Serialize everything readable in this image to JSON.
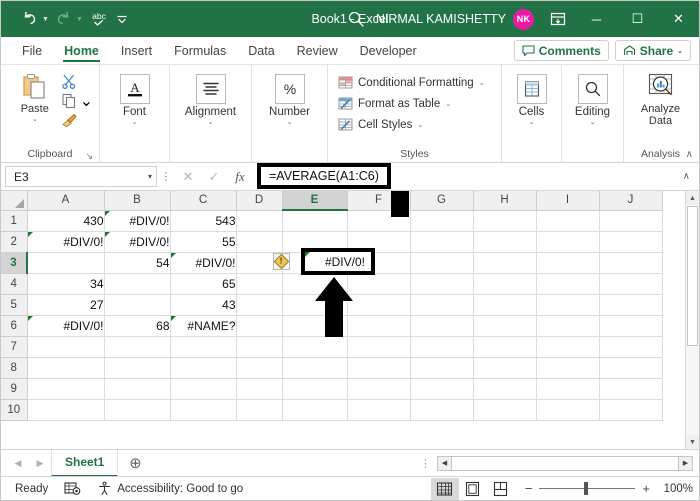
{
  "titlebar": {
    "document_title": "Book1 - Excel",
    "user_name": "NIRMAL KAMISHETTY",
    "avatar_initials": "NK",
    "qat": [
      {
        "name": "undo",
        "label": "↶"
      },
      {
        "name": "redo",
        "label": "↷"
      },
      {
        "name": "spelling",
        "label": "abc"
      },
      {
        "name": "customize-qat",
        "label": "⌄"
      }
    ],
    "window_buttons": {
      "minimize": "─",
      "maximize": "☐",
      "close": "✕"
    },
    "brand_color": "#217346",
    "avatar_color": "#e81aa4"
  },
  "tabs": [
    {
      "label": "File",
      "active": false
    },
    {
      "label": "Home",
      "active": true
    },
    {
      "label": "Insert",
      "active": false
    },
    {
      "label": "Formulas",
      "active": false
    },
    {
      "label": "Data",
      "active": false
    },
    {
      "label": "Review",
      "active": false
    },
    {
      "label": "Developer",
      "active": false
    }
  ],
  "tabstrip_right": {
    "comments_label": "Comments",
    "share_label": "Share",
    "share_caret": "⌄"
  },
  "ribbon": {
    "groups": [
      {
        "name": "clipboard",
        "label": "Clipboard",
        "dialog_launcher": "↘",
        "buttons": [
          {
            "name": "paste",
            "label": "Paste",
            "caret": "⌄"
          },
          {
            "name": "cut",
            "label": ""
          },
          {
            "name": "copy",
            "label": "",
            "caret": "⌄"
          },
          {
            "name": "format-painter",
            "label": ""
          }
        ]
      },
      {
        "name": "font",
        "label": "",
        "button": {
          "name": "font",
          "label": "Font",
          "caret": "⌄"
        }
      },
      {
        "name": "alignment",
        "label": "",
        "button": {
          "name": "alignment",
          "label": "Alignment",
          "caret": "⌄"
        }
      },
      {
        "name": "number",
        "label": "",
        "button": {
          "name": "number",
          "label": "Number",
          "caret": "⌄"
        }
      },
      {
        "name": "styles",
        "label": "Styles",
        "items": [
          {
            "name": "conditional-formatting",
            "label": "Conditional Formatting",
            "caret": "⌄"
          },
          {
            "name": "format-as-table",
            "label": "Format as Table",
            "caret": "⌄"
          },
          {
            "name": "cell-styles",
            "label": "Cell Styles",
            "caret": "⌄"
          }
        ]
      },
      {
        "name": "cells",
        "label": "",
        "button": {
          "name": "cells",
          "label": "Cells",
          "caret": "⌄"
        }
      },
      {
        "name": "editing",
        "label": "",
        "button": {
          "name": "editing",
          "label": "Editing",
          "caret": "⌄"
        }
      },
      {
        "name": "analysis",
        "label": "Analysis",
        "button": {
          "name": "analyze-data",
          "label_line1": "Analyze",
          "label_line2": "Data"
        }
      }
    ],
    "collapse_caret": "∧"
  },
  "formula_bar": {
    "name_box_value": "E3",
    "name_box_caret": "▾",
    "cancel_icon": "✕",
    "enter_icon": "✓",
    "fx_label": "fx",
    "formula_value": "=AVERAGE(A1:C6)",
    "expand_caret": "∧"
  },
  "grid": {
    "columns": [
      "A",
      "B",
      "C",
      "D",
      "E",
      "F",
      "G",
      "H",
      "I",
      "J"
    ],
    "selected_column": "E",
    "rows": [
      "1",
      "2",
      "3",
      "4",
      "5",
      "6",
      "7",
      "8",
      "9",
      "10"
    ],
    "selected_row": "3",
    "active_cell": "E3",
    "active_cell_value": "#DIV/0!",
    "error_indicator_tooltip": "!",
    "cells": [
      {
        "ref": "A1",
        "value": "430",
        "type": "num",
        "flag": false
      },
      {
        "ref": "B1",
        "value": "#DIV/0!",
        "type": "err",
        "flag": true
      },
      {
        "ref": "C1",
        "value": "543",
        "type": "num",
        "flag": false
      },
      {
        "ref": "A2",
        "value": "#DIV/0!",
        "type": "err",
        "flag": true
      },
      {
        "ref": "B2",
        "value": "#DIV/0!",
        "type": "err",
        "flag": true
      },
      {
        "ref": "C2",
        "value": "55",
        "type": "num",
        "flag": false
      },
      {
        "ref": "B3",
        "value": "54",
        "type": "num",
        "flag": false
      },
      {
        "ref": "C3",
        "value": "#DIV/0!",
        "type": "err",
        "flag": true
      },
      {
        "ref": "A4",
        "value": "34",
        "type": "num",
        "flag": false
      },
      {
        "ref": "C4",
        "value": "65",
        "type": "num",
        "flag": false
      },
      {
        "ref": "A5",
        "value": "27",
        "type": "num",
        "flag": false
      },
      {
        "ref": "C5",
        "value": "43",
        "type": "num",
        "flag": false
      },
      {
        "ref": "A6",
        "value": "#DIV/0!",
        "type": "err",
        "flag": true
      },
      {
        "ref": "B6",
        "value": "68",
        "type": "num",
        "flag": false
      },
      {
        "ref": "C6",
        "value": "#NAME?",
        "type": "err",
        "flag": true
      }
    ]
  },
  "sheetbar": {
    "prev_arrow": "◀",
    "next_arrow": "▶",
    "sheets": [
      {
        "label": "Sheet1",
        "active": true
      }
    ],
    "add_sheet": "⊕",
    "dots": "⋮",
    "hscroll_left": "◀",
    "hscroll_right": "▶"
  },
  "statusbar": {
    "mode": "Ready",
    "accessibility": "Accessibility: Good to go",
    "views": [
      {
        "name": "normal-view",
        "active": true
      },
      {
        "name": "page-layout-view",
        "active": false
      },
      {
        "name": "page-break-preview",
        "active": false
      }
    ],
    "zoom_minus": "−",
    "zoom_plus": "+",
    "zoom_level": "100%"
  }
}
